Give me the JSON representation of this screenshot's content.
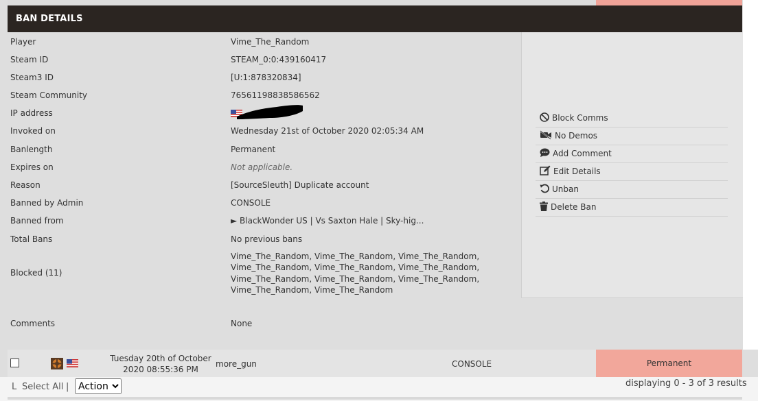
{
  "header": {
    "title": "BAN DETAILS"
  },
  "details": [
    {
      "label": "Player",
      "value": "Vime_The_Random"
    },
    {
      "label": "Steam ID",
      "value": "STEAM_0:0:439160417"
    },
    {
      "label": "Steam3 ID",
      "value": "[U:1:878320834]"
    },
    {
      "label": "Steam Community",
      "value": "76561198838586562"
    },
    {
      "label": "IP address",
      "value": ""
    },
    {
      "label": "Invoked on",
      "value": "Wednesday 21st of October 2020 02:05:34 AM"
    },
    {
      "label": "Banlength",
      "value": "Permanent"
    },
    {
      "label": "Expires on",
      "value": "Not applicable."
    },
    {
      "label": "Reason",
      "value": "[SourceSleuth] Duplicate account"
    },
    {
      "label": "Banned by Admin",
      "value": "CONSOLE"
    },
    {
      "label": "Banned from",
      "value": "► BlackWonder US | Vs Saxton Hale | Sky-hig..."
    },
    {
      "label": "Total Bans",
      "value": "No previous bans"
    },
    {
      "label": "Blocked (11)",
      "lines": [
        "Vime_The_Random, Vime_The_Random, Vime_The_Random,",
        "Vime_The_Random, Vime_The_Random, Vime_The_Random,",
        "Vime_The_Random, Vime_The_Random, Vime_The_Random,",
        "Vime_The_Random, Vime_The_Random"
      ]
    },
    {
      "label": "Comments",
      "value": "None"
    }
  ],
  "actions": [
    {
      "label": "Block Comms",
      "icon": "block-icon"
    },
    {
      "label": "No Demos",
      "icon": "video-off-icon"
    },
    {
      "label": "Add Comment",
      "icon": "comment-icon"
    },
    {
      "label": "Edit Details",
      "icon": "edit-icon"
    },
    {
      "label": "Unban",
      "icon": "undo-icon"
    },
    {
      "label": "Delete Ban",
      "icon": "trash-icon"
    }
  ],
  "ban_row": {
    "date_line1": "Tuesday 20th of October",
    "date_line2": "2020 08:55:36 PM",
    "player": "more_gun",
    "admin": "CONSOLE",
    "length": "Permanent"
  },
  "footer": {
    "select_all": "Select All",
    "separator": "|",
    "corner": "L",
    "action_selected": "Action",
    "results": "displaying 0 - 3 of 3 results"
  },
  "colors": {
    "header_bg": "#2b2521",
    "permanent_bg": "#f2a79b"
  }
}
